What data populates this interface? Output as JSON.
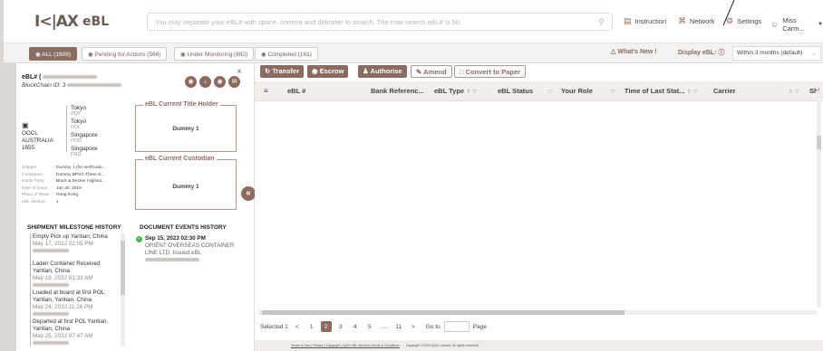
{
  "app": {
    "logo_mark": "I<|AX",
    "logo_text": "eBL",
    "search_placeholder": "You may separate your eBL# with space, comma and delimiter to search. The max search eBL# is 50.",
    "nav": {
      "instruction": "Instruction",
      "network": "Network",
      "settings": "Settings",
      "user": "Miss Carm..."
    }
  },
  "tabs": [
    {
      "label": "ALL (1609)"
    },
    {
      "label": "Pending for Actions (566)"
    },
    {
      "label": "Under Monitoring (882)"
    },
    {
      "label": "Completed (161)"
    }
  ],
  "subbar": {
    "whats_new": "What's New !",
    "display_label": "Display eBL:",
    "display_value": "Within 3 months (default)"
  },
  "detail": {
    "ebl_label": "eBL# (",
    "blockchain_label": "BlockChain ID: 3",
    "carrier": [
      "OOCL",
      "AUSTRALIA",
      "1655"
    ],
    "route": [
      {
        "city": "Tokyo",
        "code": "POF"
      },
      {
        "city": "Tokyo",
        "code": "POL"
      },
      {
        "city": "Singapore",
        "code": "POD"
      },
      {
        "city": "Singapore",
        "code": "FND"
      }
    ],
    "holder_label": "eBL Current Title Holder",
    "holder_value": "Dummy 1",
    "custodian_label": "eBL Current Custodian",
    "custodian_value": "Dummy 1",
    "fields": [
      {
        "k": "Shipper",
        "v": "Dummy 1 (for verificatio..."
      },
      {
        "k": "Consignee",
        "v": "Dummy BPSC Three sl..."
      },
      {
        "k": "Notify Party",
        "v": "Black & Decker Highwo..."
      },
      {
        "k": "Date of Issue",
        "v": "Jan 30, 2018"
      },
      {
        "k": "Place of Issue",
        "v": "Hong Kong"
      },
      {
        "k": "eBL Version",
        "v": "1"
      }
    ],
    "milestone_title": "SHIPMENT MILESTONE HISTORY",
    "milestones": [
      {
        "t": "Empty Pick up Yantian, China",
        "d": "May 17, 2022 02:05 PM"
      },
      {
        "t": "Laden Container Received Yantian, China",
        "d": "May 19, 2022 01:33 AM"
      },
      {
        "t": "Loaded at board at first POL Yantian, Yantian, China",
        "d": "May 24, 2022 11:26 PM"
      },
      {
        "t": "Departed at first POL Yantian, Yantian, China",
        "d": "May 25, 2022 07:47 AM"
      }
    ],
    "events_title": "DOCUMENT EVENTS HISTORY",
    "event": {
      "date": "Sep 15, 2023 02:30 PM",
      "line1": "ORIENT OVERSEAS CONTAINER",
      "line2": "LINE LTD. Issued eBL"
    }
  },
  "actions": {
    "transfer": "Transfer",
    "escrow": "Escrow",
    "authorise": "Authorise",
    "amend": "Amend",
    "convert": "Convert to Paper"
  },
  "table": {
    "columns": [
      "eBL #",
      "Bank Referenc...",
      "eBL Type",
      "eBL Status",
      "Your Role",
      "Time of Last Stat...",
      "Carrier",
      "Shi"
    ]
  },
  "pager": {
    "selected": "Selected 1",
    "pages": [
      "1",
      "2",
      "3",
      "4",
      "5",
      "....",
      "11"
    ],
    "current": "2",
    "goto": "Go to",
    "page": "Page"
  },
  "footer": {
    "links": "Terms of Use | Privacy | Copyright | IQAX eBL Services Terms & Conditions",
    "copyright": "Copyright ©2023 IQAX Limited. All rights reserved."
  }
}
